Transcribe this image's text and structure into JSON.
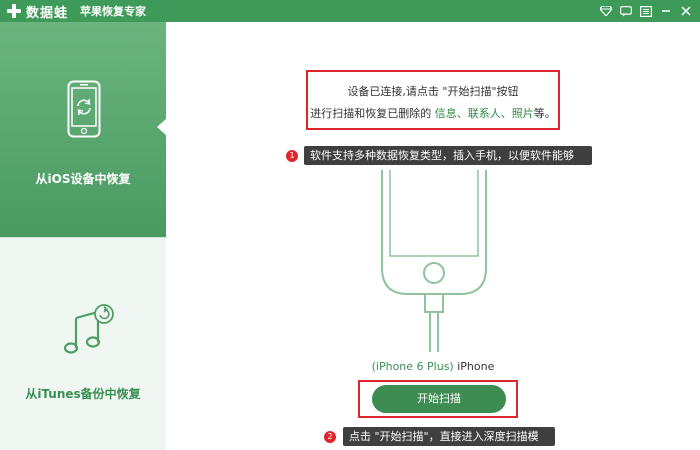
{
  "titlebar": {
    "logo_text": "数据蛙",
    "app_subtitle": "苹果恢复专家",
    "controls": [
      "diamond-icon",
      "chat-icon",
      "menu-icon",
      "minimize-icon",
      "close-icon"
    ]
  },
  "sidebar": {
    "items": [
      {
        "label": "从iOS设备中恢复",
        "icon": "iphone-restore-icon",
        "active": true
      },
      {
        "label": "从iTunes备份中恢复",
        "icon": "music-note-icon",
        "active": false
      }
    ]
  },
  "main": {
    "intro": {
      "line1": "设备已连接,请点击 \"开始扫描\"按钮",
      "line2_prefix": "进行扫描和恢复已删除的 ",
      "line2_highlight": "信息、联系人、照片",
      "line2_suffix": "等。"
    },
    "tip1": {
      "number": "1",
      "text": "软件支持多种数据恢复类型，插入手机，以便软件能够识别"
    },
    "device": {
      "model": "(iPhone 6 Plus)",
      "name": " iPhone"
    },
    "scan_button": "开始扫描",
    "tip2": {
      "number": "2",
      "text": "点击 \"开始扫描\"，直接进入深度扫描模式"
    }
  },
  "colors": {
    "brand_green": "#3d9a59",
    "sidebar_active": "#5aa870",
    "button_green": "#3d8c52",
    "highlight_red": "#e0262c",
    "tip_bg": "#3f3f3f"
  }
}
